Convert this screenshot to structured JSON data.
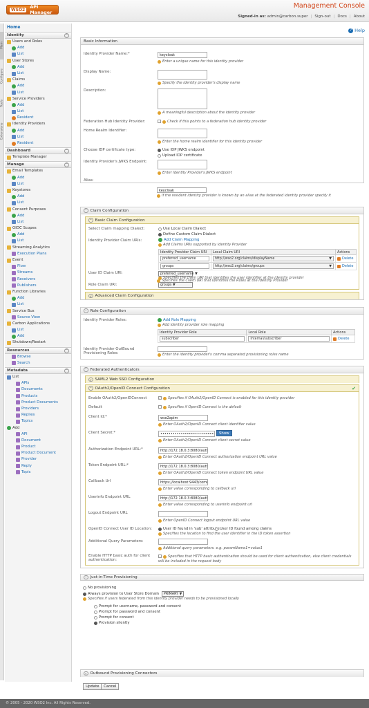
{
  "header": {
    "app_name": "API Manager",
    "wso2": "WSO2",
    "title": "Management Console",
    "signed_in_label": "Signed-in as:",
    "user": "admin@carbon.super",
    "signout": "Sign-out",
    "docs": "Docs",
    "about": "About"
  },
  "left_tabs": [
    "Main",
    "Configure",
    "Tools",
    "Extensions"
  ],
  "sidebar": {
    "home": "Home",
    "identity": {
      "title": "Identity",
      "items": [
        "Users and Roles",
        "Add",
        "List",
        "User Stores",
        "Add",
        "List",
        "Claims",
        "Add",
        "List",
        "Service Providers",
        "Add",
        "List",
        "Resident",
        "Identity Providers",
        "Add",
        "List",
        "Resident"
      ]
    },
    "dashboard": {
      "title": "Dashboard",
      "items": [
        "Template Manager"
      ]
    },
    "manage": {
      "title": "Manage",
      "items": [
        "Email Templates",
        "Add",
        "List",
        "Keystores",
        "Add",
        "List",
        "Consent Purposes",
        "Add",
        "List",
        "OIDC Scopes",
        "Add",
        "List",
        "Streaming Analytics",
        "Execution Plans",
        "Event",
        "Flow",
        "Streams",
        "Receivers",
        "Publishers",
        "Function Libraries",
        "Add",
        "List",
        "Service Bus",
        "Source View",
        "Carbon Applications",
        "List",
        "Add",
        "Shutdown/Restart"
      ]
    },
    "resources": {
      "title": "Resources",
      "items": [
        "Browse",
        "Search"
      ]
    },
    "metadata": {
      "title": "Metadata",
      "items": [
        "List",
        "APIs",
        "Documents",
        "Products",
        "Product Documents",
        "Providers",
        "Replies",
        "Topics",
        "Add",
        "API",
        "Document",
        "Product",
        "Product Document",
        "Provider",
        "Reply",
        "Topic"
      ]
    }
  },
  "help": "Help",
  "basic": {
    "title": "Basic Information",
    "idp_name_label": "Identity Provider Name:*",
    "idp_name": "keycloak",
    "idp_name_hint": "Enter a unique name for this identity provider",
    "display_name_label": "Display Name:",
    "display_name_hint": "Specify the identity provider's display name",
    "description_label": "Description:",
    "description_hint": "A meaningful description about the identity provider",
    "fed_hub_label": "Federation Hub Identity Provider:",
    "fed_hub_hint": "Check if this points to a federation hub identity provider",
    "home_realm_label": "Home Realm Identifier:",
    "home_realm_hint": "Enter the home realm identifier for this identity provider",
    "cert_type_label": "Choose IDP certificate type:",
    "cert_opt1": "Use IDP JWKS endpoint",
    "cert_opt2": "Upload IDP certificate",
    "jwks_label": "Identity Provider's JWKS Endpoint:",
    "jwks_hint": "Enter Identity Provider's JWKS endpoint",
    "alias_label": "Alias:",
    "alias": "keycloak",
    "alias_hint": "If the resident identity provider is known by an alias at the federated identity provider specify it"
  },
  "claim": {
    "title": "Claim Configuration",
    "basic_title": "Basic Claim Configuration",
    "dialect_label": "Select Claim mapping Dialect:",
    "dialect_opt1": "Use Local Claim Dialect",
    "dialect_opt2": "Define Custom Claim Dialect",
    "idp_claims_label": "Identity Provider Claim URIs:",
    "add_mapping": "Add Claim Mapping",
    "add_mapping_hint": "Add Claims URIs supported by Identity Provider",
    "cols": [
      "Identity Provider Claim URI",
      "Local Claim URI",
      "Actions"
    ],
    "rows": [
      {
        "idp": "preferred_username",
        "local": "http://wso2.org/claims/displayName",
        "action": "Delete"
      },
      {
        "idp": "groups",
        "local": "http://wso2.org/claims/groups",
        "action": "Delete"
      }
    ],
    "user_id_label": "User ID Claim URI:",
    "user_id_value": "preferred_username",
    "user_id_hint": "Specifies the claim URI that identifies the user identifier at the identity provider",
    "role_label": "Role Claim URI:",
    "role_value": "groups",
    "role_hint": "Specifies the Claim URI that identifies the Roles at the Identity Provider",
    "advanced_title": "Advanced Claim Configuration"
  },
  "role": {
    "title": "Role Configuration",
    "idp_roles_label": "Identity Provider Roles:",
    "add_role": "Add Role Mapping",
    "add_role_hint": "Add identity provider role mapping",
    "cols": [
      "Identity Provider Role",
      "Local Role",
      "Actions"
    ],
    "rows": [
      {
        "idp": "subscriber",
        "local": "Internal/subscriber",
        "action": "Delete"
      }
    ],
    "outbound_label": "Identity Provider OutBound Provisioning Roles:",
    "outbound_hint": "Enter the identity provider's comma separated provisioning roles name"
  },
  "fed": {
    "title": "Federated Authenticators",
    "saml_title": "SAML2 Web SSO Configuration",
    "oidc_title": "OAuth2/OpenID Connect Configuration",
    "enable_label": "Enable OAuth2/OpenIDConnect",
    "enable_hint": "Specifies if OAuth2/OpenID Connect is enabled for this identity provider",
    "default_label": "Default",
    "default_hint": "Specifies if OpenID Connect is the default",
    "client_id_label": "Client Id:*",
    "client_id": "wso2apim",
    "client_id_hint": "Enter OAuth2/OpenID Connect client identifier value",
    "secret_label": "Client Secret:*",
    "secret": "••••••••••••••••••••••••••••••••••••",
    "show": "Show",
    "secret_hint": "Enter OAuth2/OpenID Connect client secret value",
    "authz_label": "Authorization Endpoint URL:*",
    "authz": "http://172.18.0.3:8080/auth/realms/mas",
    "authz_hint": "Enter OAuth2/OpenID Connect authorization endpoint URL value",
    "token_label": "Token Endpoint URL:*",
    "token": "http://172.18.0.3:8080/auth/realms/mas",
    "token_hint": "Enter OAuth2/OpenID Connect token endpoint URL value",
    "callback_label": "Callback Url",
    "callback": "https://localhost:9443/commonauth",
    "callback_hint": "Enter value corresponding to callback url",
    "userinfo_label": "Userinfo Endpoint URL",
    "userinfo": "http://172.18.0.3:8080/auth/realms/mas",
    "userinfo_hint": "Enter value corresponding to userinfo endpoint url",
    "logout_label": "Logout Endpoint URL",
    "logout_hint": "Enter OpenID Connect logout endpoint URL value",
    "uid_loc_label": "OpenID Connect User ID Location:",
    "uid_opt1": "User ID found in 'sub' attribute",
    "uid_opt2": "User ID found among claims",
    "uid_hint": "Specifies the location to find the user identifier in the ID token assertion",
    "addq_label": "Additional Query Parameters:",
    "addq_hint": "Additional query parameters. e.g. paramName1=value1",
    "basic_auth_label": "Enable HTTP basic auth for client authentication:",
    "basic_auth_hint1": "Specifies that HTTP basic authentication should be used for client authentication, else client credentials",
    "basic_auth_hint2": "will be included in the request body"
  },
  "jit": {
    "title": "Just-in-Time Provisioning",
    "opt_none": "No provisioning",
    "opt_always": "Always provision to User Store Domain",
    "domain": "PRIMARY",
    "hint": "Specifies if users federated from this identity provider needs to be provisioned locally",
    "sub_opts": [
      "Prompt for username, password and consent",
      "Prompt for password and consent",
      "Prompt for consent",
      "Provision silently"
    ]
  },
  "outbound": {
    "title": "Outbound Provisioning Connectors"
  },
  "buttons": {
    "update": "Update",
    "cancel": "Cancel"
  },
  "footer": "© 2005 - 2020 WSO2 Inc. All Rights Reserved."
}
